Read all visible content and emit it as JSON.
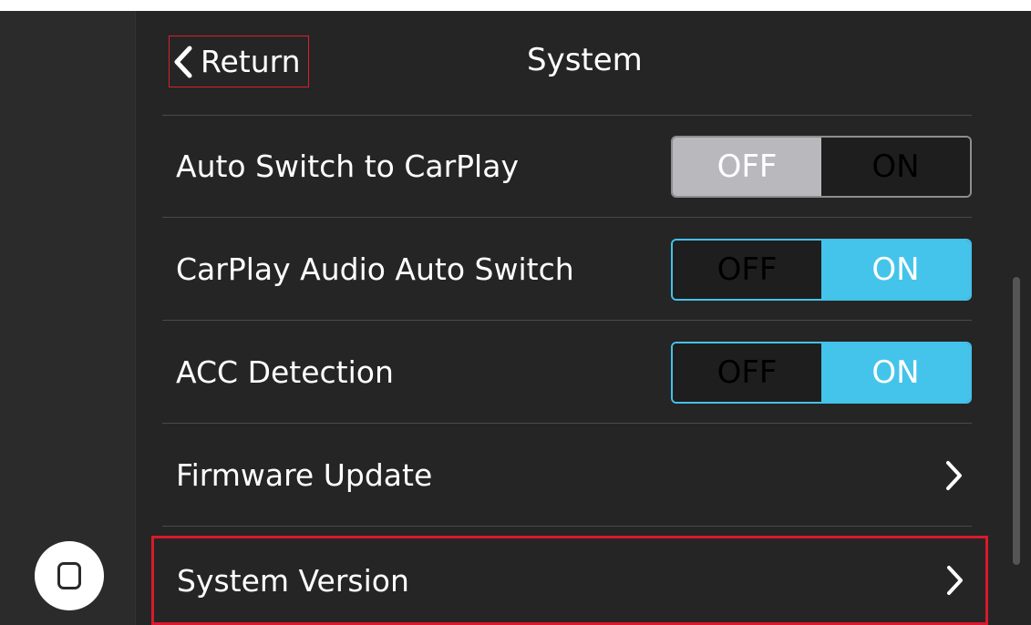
{
  "header": {
    "return_label": "Return",
    "title": "System"
  },
  "settings": [
    {
      "label": "Auto Switch to CarPlay",
      "type": "toggle",
      "value": "OFF",
      "off_label": "OFF",
      "on_label": "ON"
    },
    {
      "label": "CarPlay Audio Auto Switch",
      "type": "toggle",
      "value": "ON",
      "off_label": "OFF",
      "on_label": "ON"
    },
    {
      "label": "ACC Detection",
      "type": "toggle",
      "value": "ON",
      "off_label": "OFF",
      "on_label": "ON"
    },
    {
      "label": "Firmware Update",
      "type": "link"
    },
    {
      "label": "System Version",
      "type": "link",
      "highlighted": true
    }
  ],
  "icons": {
    "back": "chevron-left-icon",
    "chevron": "chevron-right-icon",
    "home": "home-icon"
  },
  "colors": {
    "background": "#252525",
    "toggle_on": "#44c4ea",
    "toggle_off": "#b8b8bd",
    "highlight": "#d9192d"
  }
}
